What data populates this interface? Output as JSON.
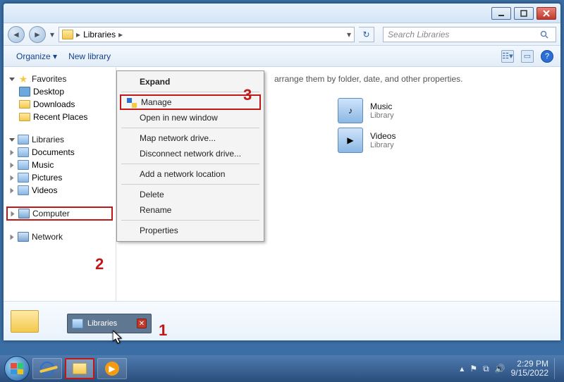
{
  "breadcrumb": {
    "root_arrow": "▸",
    "path": "Libraries",
    "sep": "▸"
  },
  "search": {
    "placeholder": "Search Libraries"
  },
  "toolbar": {
    "organize": "Organize ▾",
    "newlib": "New library"
  },
  "sidebar": {
    "favorites": {
      "label": "Favorites",
      "items": [
        "Desktop",
        "Downloads",
        "Recent Places"
      ]
    },
    "libraries": {
      "label": "Libraries",
      "items": [
        "Documents",
        "Music",
        "Pictures",
        "Videos"
      ]
    },
    "computer": {
      "label": "Computer"
    },
    "network": {
      "label": "Network"
    }
  },
  "content": {
    "hint_tail": "arrange them by folder, date, and other properties.",
    "tiles": [
      {
        "name": "Music",
        "sub": "Library"
      },
      {
        "name": "Videos",
        "sub": "Library"
      }
    ]
  },
  "context_menu": {
    "expand": "Expand",
    "manage": "Manage",
    "open_new": "Open in new window",
    "map": "Map network drive...",
    "disconnect": "Disconnect network drive...",
    "add_loc": "Add a network location",
    "delete": "Delete",
    "rename": "Rename",
    "properties": "Properties"
  },
  "thumb": {
    "label": "Libraries"
  },
  "callouts": {
    "one": "1",
    "two": "2",
    "three": "3"
  },
  "tray": {
    "time": "2:29 PM",
    "date": "9/15/2022",
    "up": "▴"
  }
}
